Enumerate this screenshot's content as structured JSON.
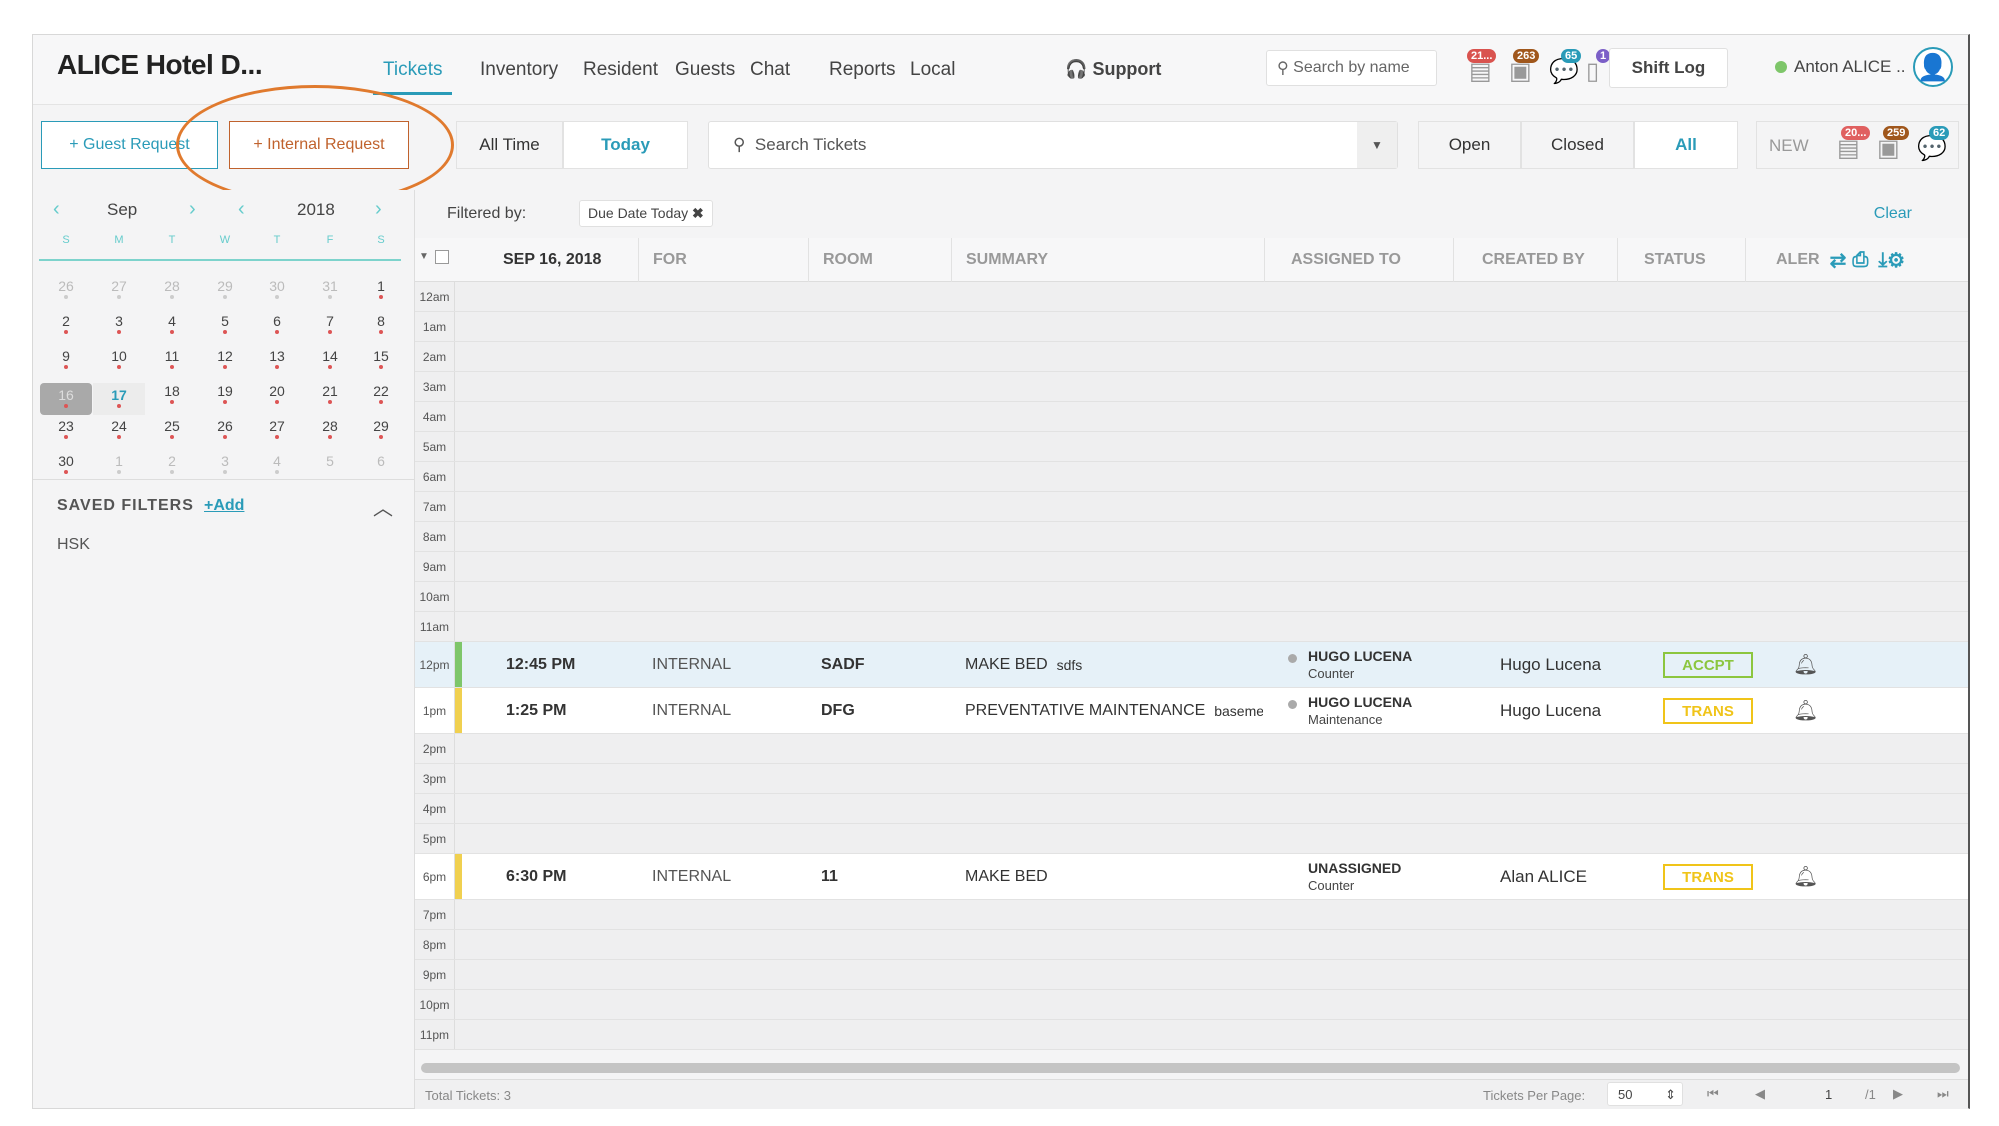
{
  "header": {
    "title": "ALICE Hotel D...",
    "nav": [
      "Tickets",
      "Inventory",
      "Resident",
      "Guests",
      "Chat",
      "Reports",
      "Local"
    ],
    "support": "Support",
    "search_placeholder": "Search by name",
    "badges": [
      "21...",
      "263",
      "65",
      "1"
    ],
    "shift_log": "Shift Log",
    "user": "Anton ALICE ..",
    "user_status_color": "#7ec66a"
  },
  "toolbar": {
    "guest_request": "+ Guest Request",
    "internal_request": "+ Internal Request",
    "all_time": "All Time",
    "today": "Today",
    "search_placeholder": "Search Tickets",
    "open": "Open",
    "closed": "Closed",
    "all": "All",
    "new": "NEW",
    "new_badges": [
      "20...",
      "259",
      "62"
    ]
  },
  "calendar": {
    "month": "Sep",
    "year": "2018",
    "weekdays": [
      "S",
      "M",
      "T",
      "W",
      "T",
      "F",
      "S"
    ],
    "days": [
      [
        "26",
        "27",
        "28",
        "29",
        "30",
        "31",
        "1"
      ],
      [
        "2",
        "3",
        "4",
        "5",
        "6",
        "7",
        "8"
      ],
      [
        "9",
        "10",
        "11",
        "12",
        "13",
        "14",
        "15"
      ],
      [
        "16",
        "17",
        "18",
        "19",
        "20",
        "21",
        "22"
      ],
      [
        "23",
        "24",
        "25",
        "26",
        "27",
        "28",
        "29"
      ],
      [
        "30",
        "1",
        "2",
        "3",
        "4",
        "5",
        "6"
      ]
    ],
    "selected": "16",
    "today": "17"
  },
  "saved_filters": {
    "title": "SAVED FILTERS",
    "add": "+Add",
    "items": [
      "HSK"
    ]
  },
  "filter": {
    "label": "Filtered by:",
    "chip": "Due Date Today",
    "clear": "Clear"
  },
  "columns": {
    "date": "SEP 16, 2018",
    "for": "FOR",
    "room": "ROOM",
    "summary": "SUMMARY",
    "assigned": "ASSIGNED TO",
    "created": "CREATED BY",
    "status": "STATUS",
    "alert": "ALER"
  },
  "hours": [
    "12am",
    "1am",
    "2am",
    "3am",
    "4am",
    "5am",
    "6am",
    "7am",
    "8am",
    "9am",
    "10am",
    "11am",
    "12pm",
    "1pm",
    "2pm",
    "3pm",
    "4pm",
    "5pm",
    "6pm",
    "7pm",
    "8pm",
    "9pm",
    "10pm",
    "11pm"
  ],
  "tickets": [
    {
      "hour": 12,
      "time": "12:45 PM",
      "for": "INTERNAL",
      "room": "SADF",
      "summary": "MAKE BED",
      "summary_note": "sdfs",
      "assignee": "HUGO LUCENA",
      "dept": "Counter",
      "created_by": "Hugo Lucena",
      "status": "ACCPT",
      "status_color": "#8cc63f",
      "bar_color": "#7ec66a",
      "highlight": true,
      "dot": true
    },
    {
      "hour": 13,
      "time": "1:25 PM",
      "for": "INTERNAL",
      "room": "DFG",
      "summary": "PREVENTATIVE MAINTENANCE",
      "summary_note": "baseme",
      "assignee": "HUGO LUCENA",
      "dept": "Maintenance",
      "created_by": "Hugo Lucena",
      "status": "TRANS",
      "status_color": "#f0c419",
      "bar_color": "#f0d050",
      "highlight": false,
      "dot": true
    },
    {
      "hour": 18,
      "time": "6:30 PM",
      "for": "INTERNAL",
      "room": "11",
      "summary": "MAKE BED",
      "summary_note": "",
      "assignee": "UNASSIGNED",
      "dept": "Counter",
      "created_by": "Alan ALICE",
      "status": "TRANS",
      "status_color": "#f0c419",
      "bar_color": "#f0d050",
      "highlight": false,
      "dot": false
    }
  ],
  "footer": {
    "total": "Total Tickets: 3",
    "per_page_label": "Tickets Per Page:",
    "per_page": "50",
    "page": "1",
    "of": "/1"
  },
  "colors": {
    "accent": "#2a9bb8",
    "annotation": "#e07a2e"
  }
}
